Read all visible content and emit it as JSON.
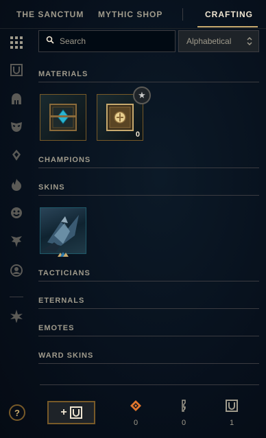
{
  "nav": {
    "tabs": [
      {
        "label": "THE SANCTUM",
        "active": false
      },
      {
        "label": "MYTHIC SHOP",
        "active": false
      },
      {
        "label": "CRAFTING",
        "active": true
      }
    ]
  },
  "sidebar": {
    "icons": [
      "grid-icon",
      "loot-box-icon",
      "champion-helmet-icon",
      "skin-mask-icon",
      "ward-icon",
      "summoner-icon",
      "emote-icon",
      "tactician-icon",
      "profile-icon",
      "eternals-icon"
    ]
  },
  "search": {
    "placeholder": "Search"
  },
  "sort": {
    "value": "Alphabetical"
  },
  "sections": {
    "materials": "MATERIALS",
    "champions": "CHAMPIONS",
    "skins": "SKINS",
    "tacticians": "TACTICIANS",
    "eternals": "ETERNALS",
    "emotes": "EMOTES",
    "ward_skins": "WARD SKINS"
  },
  "materials": [
    {
      "name": "hextech-chest",
      "count": ""
    },
    {
      "name": "masterwork-chest",
      "count": "0"
    }
  ],
  "footer": {
    "help": "?",
    "add_label": "+",
    "currencies": [
      {
        "name": "orange-essence-icon",
        "value": "0"
      },
      {
        "name": "key-icon",
        "value": "0"
      },
      {
        "name": "chest-icon",
        "value": "1"
      }
    ]
  },
  "colors": {
    "gold": "#c8aa6e",
    "orange": "#e2762d",
    "text": "#a09b8c",
    "border": "#3c3c41"
  }
}
